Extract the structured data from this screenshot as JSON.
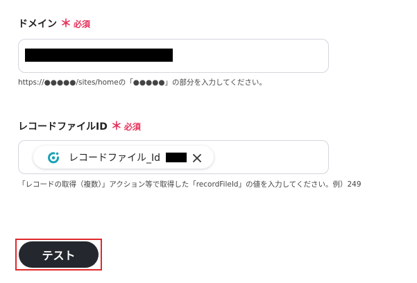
{
  "domain_field": {
    "label": "ドメイン",
    "required_mark": "＊",
    "required_text": "必須",
    "value_redacted": true,
    "help_text": "https://●●●●●/sites/homeの「●●●●●」の部分を入力してください。"
  },
  "record_file_field": {
    "label": "レコードファイルID",
    "required_mark": "＊",
    "required_text": "必須",
    "chip": {
      "icon": "app-logo-icon",
      "label": "レコードファイル_Id",
      "value_redacted": true,
      "remove_icon": "close-icon"
    },
    "help_text": "「レコードの取得（複数）」アクション等で取得した「recordFileId」の値を入力してください。例）249"
  },
  "actions": {
    "test_label": "テスト"
  },
  "colors": {
    "required": "#e5315a",
    "button_bg": "#24272e",
    "highlight": "#e0282c",
    "icon_teal": "#1aa1b5"
  }
}
